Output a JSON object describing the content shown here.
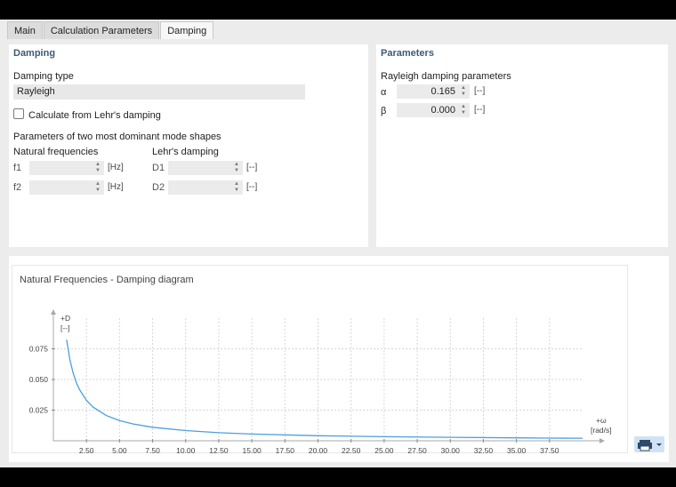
{
  "tabs": [
    {
      "label": "Main"
    },
    {
      "label": "Calculation Parameters"
    },
    {
      "label": "Damping",
      "active": true
    }
  ],
  "damping": {
    "title": "Damping",
    "type_label": "Damping type",
    "type_value": "Rayleigh",
    "lehr_checkbox_label": "Calculate from Lehr's damping",
    "lehr_checked": false,
    "dominant_label": "Parameters of two most dominant mode shapes",
    "natural_freq_label": "Natural frequencies",
    "lehr_damping_label": "Lehr's damping",
    "f1_label": "f1",
    "f2_label": "f2",
    "d1_label": "D1",
    "d2_label": "D2",
    "hz_unit": "[Hz]",
    "dimless_unit": "[--]"
  },
  "parameters": {
    "title": "Parameters",
    "rayleigh_label": "Rayleigh damping parameters",
    "alpha_label": "α",
    "alpha_value": "0.165",
    "beta_label": "β",
    "beta_value": "0.000",
    "unit": "[--]"
  },
  "chart_panel": {
    "title": "Natural Frequencies - Damping diagram",
    "print_icon": "printer-icon"
  },
  "chart_data": {
    "type": "line",
    "ylabel": "+D",
    "yunit": "[--]",
    "xlabel": "+ω",
    "xunit": "[rad/s]",
    "xlim": [
      0,
      40
    ],
    "ylim": [
      0,
      0.1
    ],
    "xticks": [
      "2.50",
      "5.00",
      "7.50",
      "10.00",
      "12.50",
      "15.00",
      "17.50",
      "20.00",
      "22.50",
      "25.00",
      "27.50",
      "30.00",
      "32.50",
      "35.00",
      "37.50"
    ],
    "yticks": [
      "0.025",
      "0.050",
      "0.075"
    ],
    "grid": true,
    "series": [
      {
        "color": "#4a9fe0",
        "x": [
          1.0,
          1.25,
          1.5,
          1.75,
          2.0,
          2.5,
          3.0,
          4.0,
          5.0,
          6.0,
          7.5,
          10.0,
          12.5,
          15.0,
          20.0,
          25.0,
          30.0,
          35.0,
          37.5,
          40.0
        ],
        "y": [
          0.0825,
          0.066,
          0.055,
          0.0471,
          0.0413,
          0.033,
          0.0275,
          0.0206,
          0.0165,
          0.0138,
          0.011,
          0.0083,
          0.0066,
          0.0055,
          0.0041,
          0.0033,
          0.0028,
          0.0024,
          0.0022,
          0.0021
        ]
      }
    ]
  }
}
